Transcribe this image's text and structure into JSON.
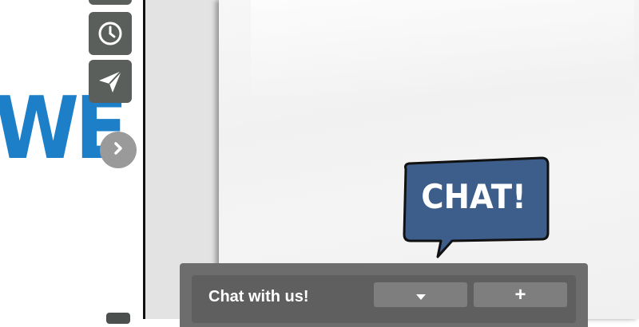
{
  "brand": {
    "partial_wordmark": "WE",
    "color": "#1e7fc9"
  },
  "toolbar": {
    "buttons": [
      {
        "icon": "unknown-icon"
      },
      {
        "icon": "clock-icon"
      },
      {
        "icon": "paper-plane-icon"
      }
    ],
    "next_icon": "chevron-right-icon"
  },
  "chat_bubble": {
    "text": "CHAT!",
    "fill": "#3d5d8a"
  },
  "chat_bar": {
    "title": "Chat with us!",
    "minimize_icon": "caret-down-icon",
    "expand_label": "+"
  }
}
